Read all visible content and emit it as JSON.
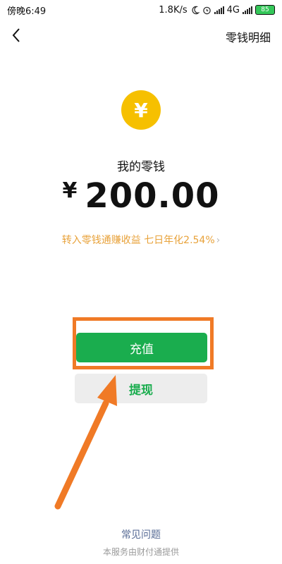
{
  "status_bar": {
    "time": "傍晚6:49",
    "network_speed": "1.8K/s",
    "network_type": "4G",
    "battery": "85"
  },
  "nav": {
    "right_label": "零钱明细",
    "back_icon": "back-arrow-icon"
  },
  "wallet": {
    "currency_icon": "yen-icon",
    "currency_glyph": "¥",
    "title": "我的零钱",
    "currency_symbol": "¥",
    "amount": "200.00",
    "promo_text": "转入零钱通赚收益 七日年化2.54%",
    "promo_chevron": "›"
  },
  "actions": {
    "recharge_label": "充值",
    "withdraw_label": "提现"
  },
  "footer": {
    "faq_label": "常见问题",
    "provider_text": "本服务由财付通提供"
  },
  "colors": {
    "primary_green": "#1aad4e",
    "coin_yellow": "#f6c000",
    "promo_orange": "#e8a23a",
    "annotation_orange": "#f07a26"
  }
}
